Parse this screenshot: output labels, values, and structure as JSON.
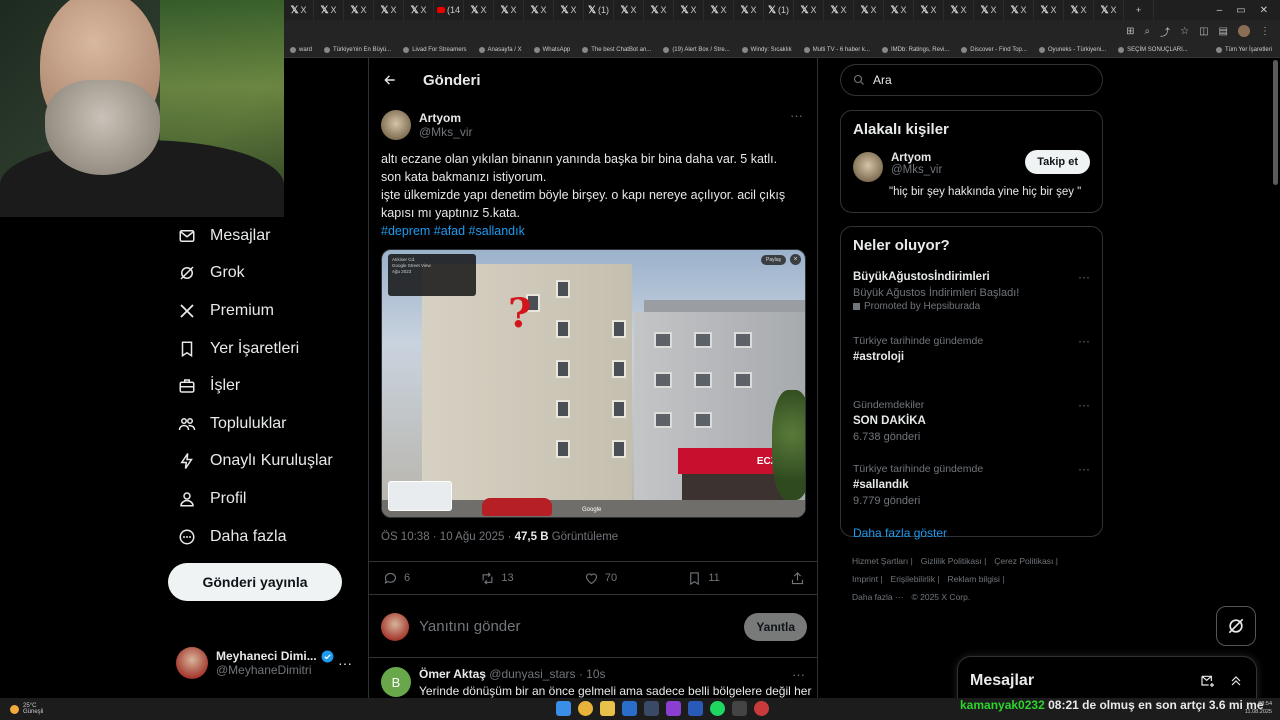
{
  "browser": {
    "tab_count": 28,
    "tab_labels": [
      "X",
      "X",
      "X",
      "X",
      "X",
      "(14",
      "X",
      "X",
      "X",
      "X",
      "(1)",
      "X",
      "X",
      "X",
      "X",
      "X",
      "(1)",
      "X",
      "X",
      "X",
      "X",
      "X",
      "X",
      "X",
      "X",
      "X",
      "X",
      "X"
    ],
    "new_tab": "+",
    "bookmarks": [
      "ward",
      "Türkiye'nin En Büyü...",
      "Livad For Streamers",
      "Anasayfa / X",
      "WhatsApp",
      "The best ChatBot an...",
      "(19) Alert Box / Stre...",
      "Windy: Sıcaklık",
      "Multi TV - 6 haber k...",
      "IMDb: Ratings, Revi...",
      "Discover - Find Top...",
      "Oyuneks - Türkiyeni...",
      "SEÇİM SONUÇLARI..."
    ],
    "bookmarks_right": "Tüm Yer İşaretleri"
  },
  "nav": {
    "items": [
      {
        "label": "Mesajlar",
        "icon": "mail-icon"
      },
      {
        "label": "Grok",
        "icon": "grok-icon"
      },
      {
        "label": "Premium",
        "icon": "x-logo-icon"
      },
      {
        "label": "Yer İşaretleri",
        "icon": "bookmark-icon"
      },
      {
        "label": "İşler",
        "icon": "briefcase-icon"
      },
      {
        "label": "Topluluklar",
        "icon": "people-icon"
      },
      {
        "label": "Onaylı Kuruluşlar",
        "icon": "lightning-icon"
      },
      {
        "label": "Profil",
        "icon": "person-icon"
      },
      {
        "label": "Daha fazla",
        "icon": "more-circle-icon"
      }
    ],
    "post_button": "Gönderi yayınla",
    "account": {
      "name": "Meyhaneci Dimi...",
      "handle": "@MeyhaneDimitri",
      "more": "···"
    }
  },
  "post": {
    "header_title": "Gönderi",
    "author_name": "Artyom",
    "author_handle": "@Mks_vir",
    "more": "···",
    "text_lines": [
      "altı eczane olan yıkılan binanın yanında başka bir bina daha var. 5 katlı.",
      "son kata bakmanızı istiyorum.",
      "işte ülkemizde yapı denetim böyle birşey. o kapı nereye açılıyor. acil çıkış",
      "kapısı mı yaptınız 5.kata."
    ],
    "hashtags": "#deprem #afad #sallandık",
    "media": {
      "question_mark": "?",
      "shop_sign": "ECZANE",
      "share": "Paylaş",
      "close": "×",
      "sv_title": "Atıkiser Cd.",
      "sv_sub": "Google Street View",
      "sv_date": "Ağu 2023",
      "google": "Google"
    },
    "time": "ÖS 10:38 · 10 Ağu 2025 · ",
    "views": "47,5 B",
    "views_label": " Görüntüleme",
    "stats": {
      "replies": "6",
      "reposts": "13",
      "likes": "70",
      "bookmarks": "11"
    },
    "reply_placeholder": "Yanıtını gönder",
    "reply_button": "Yanıtla"
  },
  "comment": {
    "avatar_letter": "B",
    "name": "Ömer Aktaş",
    "handle": "@dunyasi_stars · 10s",
    "text": "Yerinde dönüşüm bir an önce gelmeli ama sadece belli bölgelere değil her",
    "more": "···"
  },
  "right": {
    "search_placeholder": "Ara",
    "related_title": "Alakalı kişiler",
    "related": {
      "name": "Artyom",
      "handle": "@Mks_vir",
      "bio": "\"hiç bir şey hakkında yine hiç bir şey \"",
      "follow": "Takip et"
    },
    "trends_title": "Neler oluyor?",
    "trends": [
      {
        "main": "BüyükAğustosİndirimleri",
        "desc": "Büyük Ağustos İndirimleri Başladı!",
        "promo": "Promoted by Hepsiburada"
      },
      {
        "sub": "Türkiye tarihinde gündemde",
        "main": "#astroloji"
      },
      {
        "sub": "Gündemdekiler",
        "main": "SON DAKİKA",
        "desc": "6.738 gönderi"
      },
      {
        "sub": "Türkiye tarihinde gündemde",
        "main": "#sallandık",
        "desc": "9.779 gönderi"
      }
    ],
    "show_more": "Daha fazla göster",
    "footer": [
      "Hizmet Şartları |",
      "Gizlilik Politikası |",
      "Çerez Politikası |",
      "Imprint |",
      "Erişilebilirlik |",
      "Reklam bilgisi |",
      "Daha fazla ···",
      "© 2025 X Corp."
    ]
  },
  "dm_drawer": {
    "title": "Mesajlar"
  },
  "taskbar": {
    "weather_temp": "25°C",
    "weather_desc": "Güneşli",
    "ticker_user": "kamanyak0232",
    "ticker_text": "08:21 de olmuş en son artçı 3.6 mi me",
    "time": "08:54",
    "date": "11.08.2025"
  }
}
